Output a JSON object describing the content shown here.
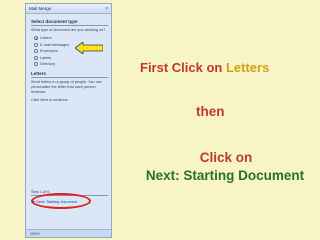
{
  "pane": {
    "title": "Mail Merge",
    "close": "×",
    "select_type_heading": "Select document type",
    "question": "What type of document are you working on?",
    "options": [
      {
        "label": "Letters",
        "selected": true
      },
      {
        "label": "E-mail messages",
        "selected": false
      },
      {
        "label": "Envelopes",
        "selected": false
      },
      {
        "label": "Labels",
        "selected": false
      },
      {
        "label": "Directory",
        "selected": false
      }
    ],
    "letters_heading": "Letters",
    "letters_desc": "Send letters to a group of people. You can personalize the letter that each person receives.",
    "continue_text": "Click Next to continue.",
    "step_label": "Step 1 of 6",
    "next_link": "Next: Starting document",
    "next_arrow": "➡",
    "zoom": "100%"
  },
  "instructions": {
    "line1_prefix": "First Click on ",
    "line1_accent": "Letters",
    "line2": "then",
    "line3": "Click on",
    "line4": "Next: Starting Document"
  },
  "colors": {
    "background": "#f7f4c6",
    "red_text": "#c0392b",
    "gold_text": "#d4a017",
    "green_text": "#2a6f2a",
    "arrow_fill": "#f7e600",
    "ellipse": "#e0201c"
  }
}
